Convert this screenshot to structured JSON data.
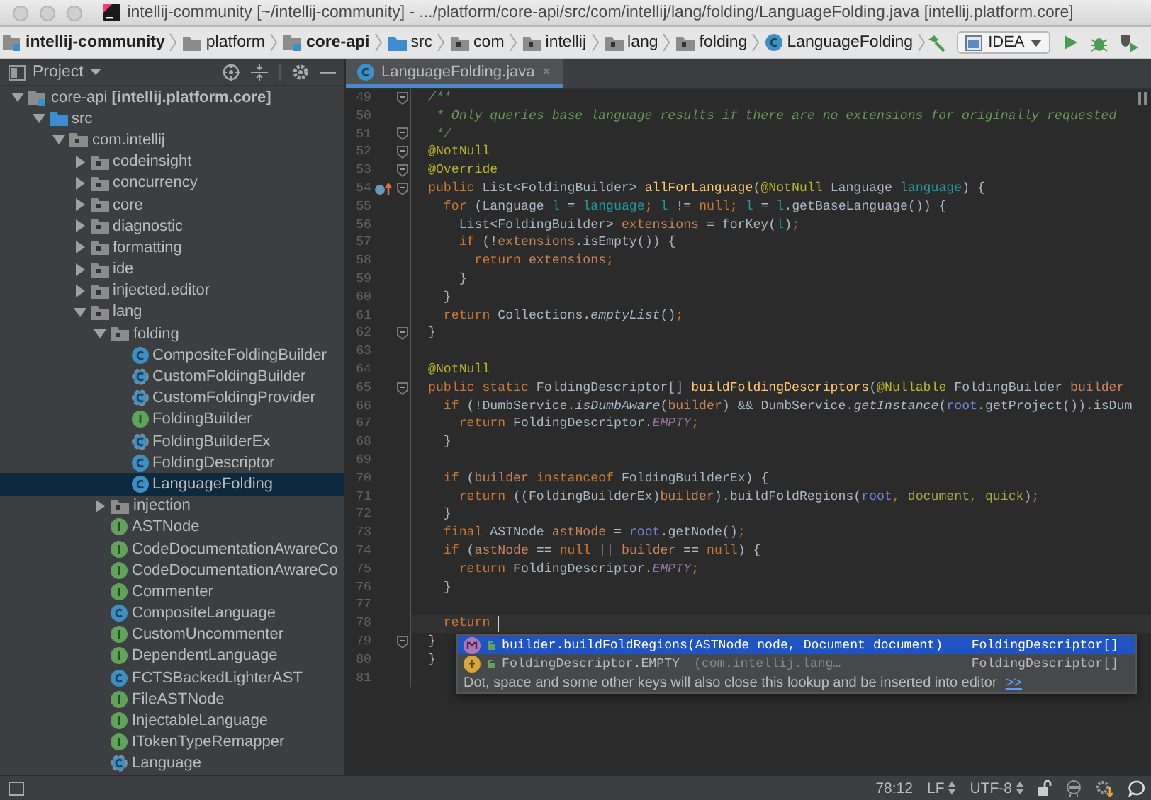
{
  "window": {
    "title": "intellij-community [~/intellij-community] - .../platform/core-api/src/com/intellij/lang/folding/LanguageFolding.java [intellij.platform.core]"
  },
  "navbar": {
    "breadcrumbs": [
      {
        "label": "intellij-community",
        "kind": "module"
      },
      {
        "label": "platform",
        "kind": "folder"
      },
      {
        "label": "core-api",
        "kind": "module"
      },
      {
        "label": "src",
        "kind": "source-folder"
      },
      {
        "label": "com",
        "kind": "package"
      },
      {
        "label": "intellij",
        "kind": "package"
      },
      {
        "label": "lang",
        "kind": "package"
      },
      {
        "label": "folding",
        "kind": "package"
      },
      {
        "label": "LanguageFolding",
        "kind": "class"
      }
    ],
    "run_config": "IDEA"
  },
  "project": {
    "title": "Project",
    "tree": [
      {
        "label": "core-api **[intellij.platform.core]**",
        "kind": "module",
        "expanded": true,
        "selected": false,
        "children": [
          {
            "label": "src",
            "kind": "source-folder",
            "expanded": true,
            "selected": false,
            "children": [
              {
                "label": "com.intellij",
                "kind": "package",
                "expanded": true,
                "selected": false,
                "children": [
                  {
                    "label": "codeinsight",
                    "kind": "package",
                    "expanded": false,
                    "selected": false
                  },
                  {
                    "label": "concurrency",
                    "kind": "package",
                    "expanded": false,
                    "selected": false
                  },
                  {
                    "label": "core",
                    "kind": "package",
                    "expanded": false,
                    "selected": false
                  },
                  {
                    "label": "diagnostic",
                    "kind": "package",
                    "expanded": false,
                    "selected": false
                  },
                  {
                    "label": "formatting",
                    "kind": "package",
                    "expanded": false,
                    "selected": false
                  },
                  {
                    "label": "ide",
                    "kind": "package",
                    "expanded": false,
                    "selected": false
                  },
                  {
                    "label": "injected.editor",
                    "kind": "package",
                    "expanded": false,
                    "selected": false
                  },
                  {
                    "label": "lang",
                    "kind": "package",
                    "expanded": true,
                    "selected": false,
                    "children": [
                      {
                        "label": "folding",
                        "kind": "package",
                        "expanded": true,
                        "selected": false,
                        "children": [
                          {
                            "label": "CompositeFoldingBuilder",
                            "kind": "class",
                            "selected": false
                          },
                          {
                            "label": "CustomFoldingBuilder",
                            "kind": "abstract-class",
                            "selected": false
                          },
                          {
                            "label": "CustomFoldingProvider",
                            "kind": "abstract-class",
                            "selected": false
                          },
                          {
                            "label": "FoldingBuilder",
                            "kind": "interface",
                            "selected": false
                          },
                          {
                            "label": "FoldingBuilderEx",
                            "kind": "abstract-class",
                            "selected": false
                          },
                          {
                            "label": "FoldingDescriptor",
                            "kind": "class",
                            "selected": false
                          },
                          {
                            "label": "LanguageFolding",
                            "kind": "class",
                            "selected": true
                          }
                        ]
                      },
                      {
                        "label": "injection",
                        "kind": "package",
                        "expanded": false,
                        "selected": false
                      },
                      {
                        "label": "ASTNode",
                        "kind": "interface",
                        "selected": false
                      },
                      {
                        "label": "CodeDocumentationAwareCo",
                        "kind": "interface",
                        "selected": false
                      },
                      {
                        "label": "CodeDocumentationAwareCo",
                        "kind": "interface",
                        "selected": false
                      },
                      {
                        "label": "Commenter",
                        "kind": "interface",
                        "selected": false
                      },
                      {
                        "label": "CompositeLanguage",
                        "kind": "class",
                        "selected": false
                      },
                      {
                        "label": "CustomUncommenter",
                        "kind": "interface",
                        "selected": false
                      },
                      {
                        "label": "DependentLanguage",
                        "kind": "interface",
                        "selected": false
                      },
                      {
                        "label": "FCTSBackedLighterAST",
                        "kind": "class",
                        "selected": false
                      },
                      {
                        "label": "FileASTNode",
                        "kind": "interface",
                        "selected": false
                      },
                      {
                        "label": "InjectableLanguage",
                        "kind": "interface",
                        "selected": false
                      },
                      {
                        "label": "ITokenTypeRemapper",
                        "kind": "interface",
                        "selected": false
                      },
                      {
                        "label": "Language",
                        "kind": "abstract-class",
                        "selected": false
                      }
                    ]
                  }
                ]
              }
            ]
          }
        ]
      }
    ]
  },
  "editor": {
    "tab": {
      "label": "LanguageFolding.java",
      "close": "×",
      "selected": true
    },
    "lines": [
      {
        "n": "49",
        "fold": true,
        "current": false,
        "overridden": false,
        "tokens": [
          {
            "kind": "c",
            "text": "/**"
          }
        ]
      },
      {
        "n": "50",
        "fold": false,
        "current": false,
        "overridden": false,
        "tokens": [
          {
            "kind": "c",
            "text": " * Only queries base language results if there are no extensions for originally requested"
          }
        ]
      },
      {
        "n": "51",
        "fold": true,
        "current": false,
        "overridden": false,
        "tokens": [
          {
            "kind": "c",
            "text": " */"
          }
        ]
      },
      {
        "n": "52",
        "fold": true,
        "current": false,
        "overridden": false,
        "tokens": [
          {
            "kind": "a",
            "text": "@NotNull"
          }
        ]
      },
      {
        "n": "53",
        "fold": true,
        "current": false,
        "overridden": false,
        "tokens": [
          {
            "kind": "a",
            "text": "@Override"
          }
        ]
      },
      {
        "n": "54",
        "fold": true,
        "current": false,
        "overridden": true,
        "tokens": [
          {
            "kind": "k",
            "text": "public "
          },
          {
            "kind": "p",
            "text": "List<FoldingBuilder> "
          },
          {
            "kind": "m",
            "text": "allForLanguage"
          },
          {
            "kind": "p",
            "text": "("
          },
          {
            "kind": "a",
            "text": "@NotNull "
          },
          {
            "kind": "p",
            "text": "Language "
          },
          {
            "kind": "v1",
            "text": "language"
          },
          {
            "kind": "p",
            "text": ") {"
          }
        ]
      },
      {
        "n": "55",
        "fold": false,
        "current": false,
        "overridden": false,
        "tokens": [
          {
            "kind": "k",
            "text": "  for "
          },
          {
            "kind": "p",
            "text": "(Language "
          },
          {
            "kind": "v1",
            "text": "l"
          },
          {
            "kind": "p",
            "text": " = "
          },
          {
            "kind": "v1",
            "text": "language"
          },
          {
            "kind": "k",
            "text": "; "
          },
          {
            "kind": "v1",
            "text": "l"
          },
          {
            "kind": "p",
            "text": " != "
          },
          {
            "kind": "k",
            "text": "null; "
          },
          {
            "kind": "v1",
            "text": "l"
          },
          {
            "kind": "p",
            "text": " = "
          },
          {
            "kind": "v1",
            "text": "l"
          },
          {
            "kind": "p",
            "text": ".getBaseLanguage()) {"
          }
        ]
      },
      {
        "n": "56",
        "fold": false,
        "current": false,
        "overridden": false,
        "tokens": [
          {
            "kind": "p",
            "text": "    List<FoldingBuilder> "
          },
          {
            "kind": "v2",
            "text": "extensions"
          },
          {
            "kind": "p",
            "text": " = forKey("
          },
          {
            "kind": "v1",
            "text": "l"
          },
          {
            "kind": "p",
            "text": ")"
          },
          {
            "kind": "k",
            "text": ";"
          }
        ]
      },
      {
        "n": "57",
        "fold": false,
        "current": false,
        "overridden": false,
        "tokens": [
          {
            "kind": "k",
            "text": "    if "
          },
          {
            "kind": "p",
            "text": "(!"
          },
          {
            "kind": "v2",
            "text": "extensions"
          },
          {
            "kind": "p",
            "text": ".isEmpty()) {"
          }
        ]
      },
      {
        "n": "58",
        "fold": false,
        "current": false,
        "overridden": false,
        "tokens": [
          {
            "kind": "k",
            "text": "      return "
          },
          {
            "kind": "v2",
            "text": "extensions"
          },
          {
            "kind": "k",
            "text": ";"
          }
        ]
      },
      {
        "n": "59",
        "fold": false,
        "current": false,
        "overridden": false,
        "tokens": [
          {
            "kind": "p",
            "text": "    }"
          }
        ]
      },
      {
        "n": "60",
        "fold": false,
        "current": false,
        "overridden": false,
        "tokens": [
          {
            "kind": "p",
            "text": "  }"
          }
        ]
      },
      {
        "n": "61",
        "fold": false,
        "current": false,
        "overridden": false,
        "tokens": [
          {
            "kind": "k",
            "text": "  return "
          },
          {
            "kind": "p",
            "text": "Collections."
          },
          {
            "kind": "i",
            "text": "emptyList"
          },
          {
            "kind": "p",
            "text": "()"
          },
          {
            "kind": "k",
            "text": ";"
          }
        ]
      },
      {
        "n": "62",
        "fold": true,
        "current": false,
        "overridden": false,
        "tokens": [
          {
            "kind": "p",
            "text": "}"
          }
        ]
      },
      {
        "n": "63",
        "fold": false,
        "current": false,
        "overridden": false
      },
      {
        "n": "64",
        "fold": false,
        "current": false,
        "overridden": false,
        "tokens": [
          {
            "kind": "a",
            "text": "@NotNull"
          }
        ]
      },
      {
        "n": "65",
        "fold": true,
        "current": false,
        "overridden": false,
        "tokens": [
          {
            "kind": "k",
            "text": "public static "
          },
          {
            "kind": "p",
            "text": "FoldingDescriptor[] "
          },
          {
            "kind": "m",
            "text": "buildFoldingDescriptors"
          },
          {
            "kind": "p",
            "text": "("
          },
          {
            "kind": "a",
            "text": "@Nullable "
          },
          {
            "kind": "p",
            "text": "FoldingBuilder "
          },
          {
            "kind": "v2",
            "text": "builder"
          }
        ]
      },
      {
        "n": "66",
        "fold": false,
        "current": false,
        "overridden": false,
        "tokens": [
          {
            "kind": "k",
            "text": "  if "
          },
          {
            "kind": "p",
            "text": "(!DumbService."
          },
          {
            "kind": "i",
            "text": "isDumbAware"
          },
          {
            "kind": "p",
            "text": "("
          },
          {
            "kind": "v2",
            "text": "builder"
          },
          {
            "kind": "p",
            "text": ") && DumbService."
          },
          {
            "kind": "i",
            "text": "getInstance"
          },
          {
            "kind": "p",
            "text": "("
          },
          {
            "kind": "v3",
            "text": "root"
          },
          {
            "kind": "p",
            "text": ".getProject()).isDum"
          }
        ]
      },
      {
        "n": "67",
        "fold": false,
        "current": false,
        "overridden": false,
        "tokens": [
          {
            "kind": "k",
            "text": "    return "
          },
          {
            "kind": "p",
            "text": "FoldingDescriptor."
          },
          {
            "kind": "s",
            "text": "EMPTY"
          },
          {
            "kind": "k",
            "text": ";"
          }
        ]
      },
      {
        "n": "68",
        "fold": false,
        "current": false,
        "overridden": false,
        "tokens": [
          {
            "kind": "p",
            "text": "  }"
          }
        ]
      },
      {
        "n": "69",
        "fold": false,
        "current": false,
        "overridden": false
      },
      {
        "n": "70",
        "fold": false,
        "current": false,
        "overridden": false,
        "tokens": [
          {
            "kind": "k",
            "text": "  if "
          },
          {
            "kind": "p",
            "text": "("
          },
          {
            "kind": "v2",
            "text": "builder "
          },
          {
            "kind": "k",
            "text": "instanceof "
          },
          {
            "kind": "p",
            "text": "FoldingBuilderEx) {"
          }
        ]
      },
      {
        "n": "71",
        "fold": false,
        "current": false,
        "overridden": false,
        "tokens": [
          {
            "kind": "k",
            "text": "    return "
          },
          {
            "kind": "p",
            "text": "((FoldingBuilderEx)"
          },
          {
            "kind": "v2",
            "text": "builder"
          },
          {
            "kind": "p",
            "text": ").buildFoldRegions("
          },
          {
            "kind": "v3",
            "text": "root"
          },
          {
            "kind": "k",
            "text": ", "
          },
          {
            "kind": "v4",
            "text": "document"
          },
          {
            "kind": "k",
            "text": ", "
          },
          {
            "kind": "v4",
            "text": "quick"
          },
          {
            "kind": "p",
            "text": ")"
          },
          {
            "kind": "k",
            "text": ";"
          }
        ]
      },
      {
        "n": "72",
        "fold": false,
        "current": false,
        "overridden": false,
        "tokens": [
          {
            "kind": "p",
            "text": "  }"
          }
        ]
      },
      {
        "n": "73",
        "fold": false,
        "current": false,
        "overridden": false,
        "tokens": [
          {
            "kind": "k",
            "text": "  final "
          },
          {
            "kind": "p",
            "text": "ASTNode "
          },
          {
            "kind": "v2",
            "text": "astNode"
          },
          {
            "kind": "p",
            "text": " = "
          },
          {
            "kind": "v3",
            "text": "root"
          },
          {
            "kind": "p",
            "text": ".getNode()"
          },
          {
            "kind": "k",
            "text": ";"
          }
        ]
      },
      {
        "n": "74",
        "fold": false,
        "current": false,
        "overridden": false,
        "tokens": [
          {
            "kind": "k",
            "text": "  if "
          },
          {
            "kind": "p",
            "text": "("
          },
          {
            "kind": "v2",
            "text": "astNode"
          },
          {
            "kind": "p",
            "text": " == "
          },
          {
            "kind": "k",
            "text": "null "
          },
          {
            "kind": "p",
            "text": "|| "
          },
          {
            "kind": "v2",
            "text": "builder"
          },
          {
            "kind": "p",
            "text": " == "
          },
          {
            "kind": "k",
            "text": "null"
          },
          {
            "kind": "p",
            "text": ") {"
          }
        ]
      },
      {
        "n": "75",
        "fold": false,
        "current": false,
        "overridden": false,
        "tokens": [
          {
            "kind": "k",
            "text": "    return "
          },
          {
            "kind": "p",
            "text": "FoldingDescriptor."
          },
          {
            "kind": "s",
            "text": "EMPTY"
          },
          {
            "kind": "k",
            "text": ";"
          }
        ]
      },
      {
        "n": "76",
        "fold": false,
        "current": false,
        "overridden": false,
        "tokens": [
          {
            "kind": "p",
            "text": "  }"
          }
        ]
      },
      {
        "n": "77",
        "fold": false,
        "current": false,
        "overridden": false
      },
      {
        "n": "78",
        "fold": false,
        "current": true,
        "overridden": false,
        "tokens": [
          {
            "kind": "k",
            "text": "  return "
          }
        ]
      },
      {
        "n": "79",
        "fold": true,
        "current": false,
        "overridden": false,
        "tokens": [
          {
            "kind": "p",
            "text": "}"
          }
        ]
      },
      {
        "n": "80",
        "fold": false,
        "current": false,
        "overridden": false,
        "tokens": [
          {
            "kind": "p",
            "text": "}"
          }
        ]
      },
      {
        "n": "81",
        "fold": false,
        "current": false,
        "overridden": false
      }
    ],
    "completion": {
      "items": [
        {
          "kind": "method",
          "text": "builder.buildFoldRegions(ASTNode node, Document document)",
          "type": "FoldingDescriptor[]",
          "selected": true
        },
        {
          "kind": "field",
          "text": "FoldingDescriptor.EMPTY",
          "hint": "(com.intellij.lang…",
          "type": "FoldingDescriptor[]",
          "selected": false
        }
      ],
      "footer": "Dot, space and some other keys will also close this lookup and be inserted into editor",
      "footer_link": ">>"
    }
  },
  "status_bar": {
    "position": "78:12",
    "line_separator": "LF",
    "encoding": "UTF-8"
  }
}
